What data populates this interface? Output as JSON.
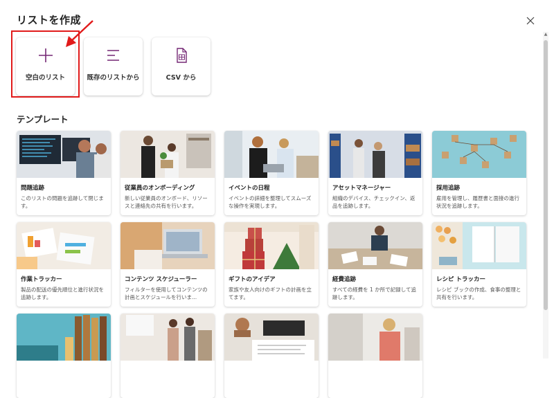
{
  "dialog": {
    "title": "リストを作成",
    "close_icon": "close-icon"
  },
  "create_options": [
    {
      "label": "空白のリスト",
      "icon": "plus-icon",
      "highlighted": true
    },
    {
      "label": "既存のリストから",
      "icon": "list-lines-icon"
    },
    {
      "label": "CSV から",
      "icon": "csv-file-icon"
    }
  ],
  "templates_title": "テンプレート",
  "templates": [
    {
      "name": "問題追跡",
      "description": "このリストの問題を追跡して閉じます。"
    },
    {
      "name": "従業員のオンボーディング",
      "description": "新しい従業員のオンボード、リソースと連絡先の共有を行います。"
    },
    {
      "name": "イベントの日程",
      "description": "イベントの詳細を整理してスムーズな操作を実現します。"
    },
    {
      "name": "アセットマネージャー",
      "description": "組織のデバイス、チェックイン、返品を追跡します。"
    },
    {
      "name": "採用追跡",
      "description": "雇用を管理し、履歴書と面接の進行状況を追跡します。"
    },
    {
      "name": "作業トラッカー",
      "description": "製品の配送の優先順位と進行状況を追跡します。"
    },
    {
      "name": "コンテンツ スケジューラー",
      "description": "フィルターを使用してコンテンツの計画とスケジュールを行いま..."
    },
    {
      "name": "ギフトのアイデア",
      "description": "家族や友人向けのギフトの計画を立てます。"
    },
    {
      "name": "経費追跡",
      "description": "すべての経費を 1 か所で記録して追跡します。"
    },
    {
      "name": "レシピ トラッカー",
      "description": "レシピ ブックの作成、食事の整理と共有を行います。"
    },
    {
      "name": "",
      "description": ""
    },
    {
      "name": "",
      "description": ""
    },
    {
      "name": "",
      "description": ""
    },
    {
      "name": "",
      "description": ""
    }
  ],
  "colors": {
    "accent": "#742774",
    "highlight": "#e11a1a"
  }
}
